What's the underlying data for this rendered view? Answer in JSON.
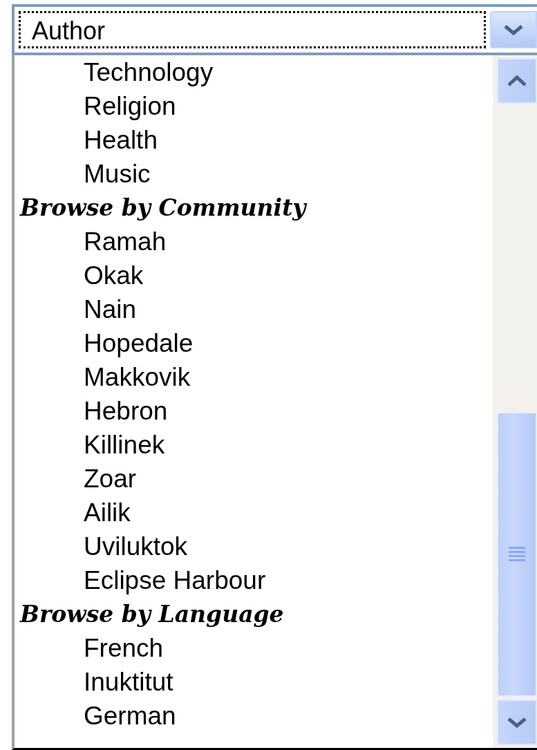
{
  "combo": {
    "value": "Author"
  },
  "list": {
    "items": [
      {
        "kind": "option",
        "label": "Technology"
      },
      {
        "kind": "option",
        "label": "Religion"
      },
      {
        "kind": "option",
        "label": "Health"
      },
      {
        "kind": "option",
        "label": "Music"
      },
      {
        "kind": "heading",
        "label": "Browse by Community"
      },
      {
        "kind": "option",
        "label": "Ramah"
      },
      {
        "kind": "option",
        "label": "Okak"
      },
      {
        "kind": "option",
        "label": "Nain"
      },
      {
        "kind": "option",
        "label": "Hopedale"
      },
      {
        "kind": "option",
        "label": "Makkovik"
      },
      {
        "kind": "option",
        "label": "Hebron"
      },
      {
        "kind": "option",
        "label": "Killinek"
      },
      {
        "kind": "option",
        "label": "Zoar"
      },
      {
        "kind": "option",
        "label": "Ailik"
      },
      {
        "kind": "option",
        "label": "Uviluktok"
      },
      {
        "kind": "option",
        "label": "Eclipse Harbour"
      },
      {
        "kind": "heading",
        "label": "Browse by Language"
      },
      {
        "kind": "option",
        "label": "French"
      },
      {
        "kind": "option",
        "label": "Inuktitut"
      },
      {
        "kind": "option",
        "label": "German"
      }
    ]
  }
}
